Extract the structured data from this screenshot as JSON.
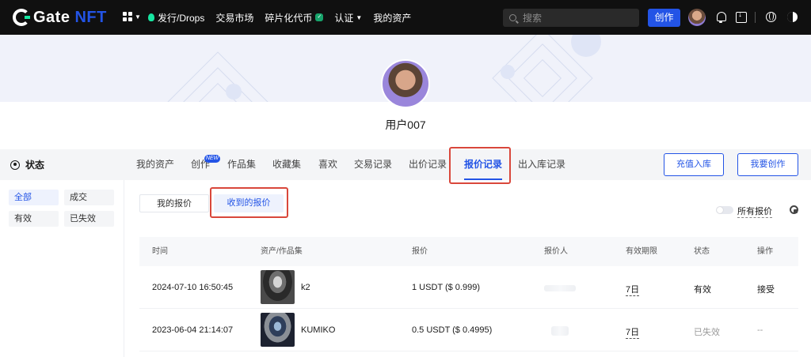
{
  "header": {
    "logo_text": "Gate",
    "logo_nft": "NFT",
    "nav": [
      "发行/Drops",
      "交易市场",
      "碎片化代币",
      "认证",
      "我的资产"
    ],
    "search_placeholder": "搜索",
    "create_label": "创作"
  },
  "profile": {
    "username": "用户007"
  },
  "sidebar": {
    "title": "状态",
    "filters": [
      {
        "label": "全部",
        "active": true
      },
      {
        "label": "成交",
        "active": false
      },
      {
        "label": "有效",
        "active": false
      },
      {
        "label": "已失效",
        "active": false
      }
    ]
  },
  "tabs": [
    {
      "label": "我的资产"
    },
    {
      "label": "创作",
      "badge": "NEW"
    },
    {
      "label": "作品集"
    },
    {
      "label": "收藏集"
    },
    {
      "label": "喜欢"
    },
    {
      "label": "交易记录"
    },
    {
      "label": "出价记录"
    },
    {
      "label": "报价记录",
      "active": true
    },
    {
      "label": "出入库记录"
    }
  ],
  "actions": {
    "deposit": "充值入库",
    "create": "我要创作"
  },
  "subtabs": [
    {
      "label": "我的报价",
      "active": false
    },
    {
      "label": "收到的报价",
      "active": true
    }
  ],
  "all_offers_label": "所有报价",
  "table": {
    "columns": [
      "时间",
      "资产/作品集",
      "报价",
      "报价人",
      "有效期限",
      "状态",
      "操作"
    ],
    "rows": [
      {
        "time": "2024-07-10 16:50:45",
        "asset": "k2",
        "offer": "1 USDT ($ 0.999)",
        "period": "7日",
        "status": "有效",
        "action": "接受"
      },
      {
        "time": "2023-06-04 21:14:07",
        "asset": "KUMIKO",
        "offer": "0.5 USDT ($ 0.4995)",
        "period": "7日",
        "status": "已失效",
        "action": "--"
      }
    ]
  },
  "colors": {
    "accent": "#2354e6",
    "highlight": "#d9473b",
    "brand_green": "#17e6a1"
  }
}
